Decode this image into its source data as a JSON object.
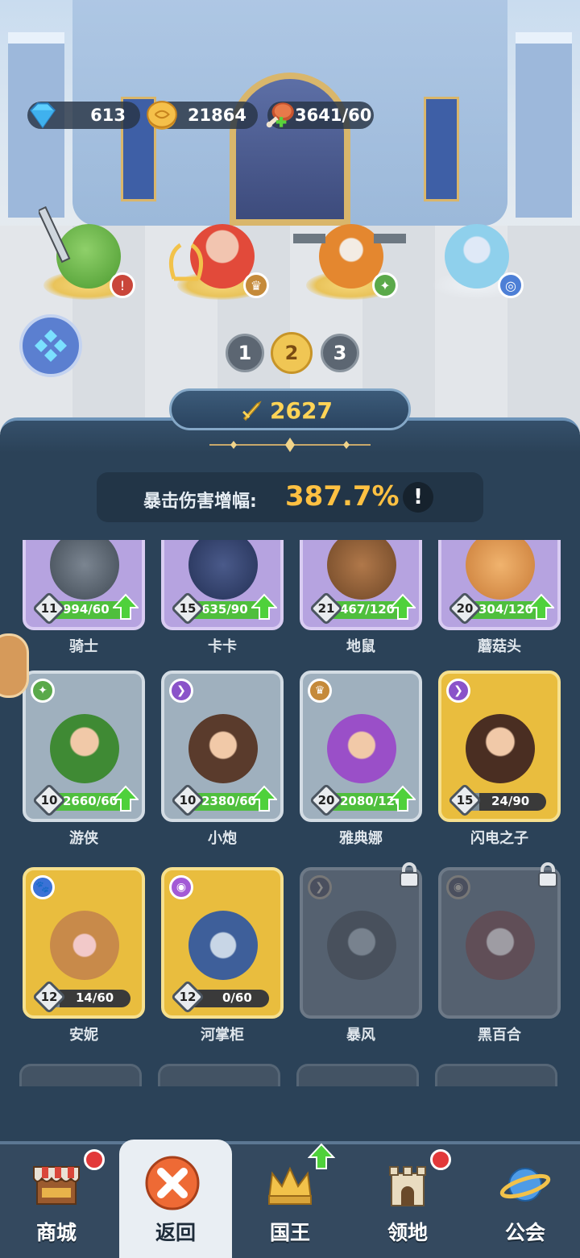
{
  "currencies": {
    "gems": "613",
    "gold": "21864",
    "stamina": "3641/60"
  },
  "team_tabs": [
    {
      "label": "1",
      "active": false
    },
    {
      "label": "2",
      "active": true
    },
    {
      "label": "3",
      "active": false
    }
  ],
  "power": "2627",
  "stat": {
    "label": "暴击伤害增幅:",
    "value": "387.7%",
    "info": "!"
  },
  "heroes_row1": [
    {
      "name": "骑士",
      "level": "11",
      "fragments": "994/60",
      "fill": 1.0,
      "rarity": "purple",
      "upgradable": true
    },
    {
      "name": "卡卡",
      "level": "15",
      "fragments": "635/90",
      "fill": 1.0,
      "rarity": "purple",
      "upgradable": true
    },
    {
      "name": "地鼠",
      "level": "21",
      "fragments": "467/120",
      "fill": 1.0,
      "rarity": "purple",
      "upgradable": true
    },
    {
      "name": "蘑菇头",
      "level": "20",
      "fragments": "304/120",
      "fill": 1.0,
      "rarity": "purple",
      "upgradable": true
    }
  ],
  "heroes_row2": [
    {
      "name": "游侠",
      "level": "10",
      "fragments": "2660/60",
      "fill": 1.0,
      "rarity": "grey",
      "upgradable": true
    },
    {
      "name": "小炮",
      "level": "10",
      "fragments": "2380/60",
      "fill": 1.0,
      "rarity": "grey",
      "upgradable": true
    },
    {
      "name": "雅典娜",
      "level": "20",
      "fragments": "2080/120",
      "fill": 1.0,
      "rarity": "grey",
      "upgradable": true
    },
    {
      "name": "闪电之子",
      "level": "15",
      "fragments": "24/90",
      "fill": 0.27,
      "rarity": "gold",
      "upgradable": false
    }
  ],
  "heroes_row3": [
    {
      "name": "安妮",
      "level": "12",
      "fragments": "14/60",
      "fill": 0.23,
      "rarity": "gold",
      "upgradable": false
    },
    {
      "name": "河掌柜",
      "level": "12",
      "fragments": "0/60",
      "fill": 0.0,
      "rarity": "gold",
      "upgradable": false
    },
    {
      "name": "暴风",
      "locked": true
    },
    {
      "name": "黑百合",
      "locked": true
    }
  ],
  "nav": {
    "shop": "商城",
    "back": "返回",
    "king": "国王",
    "territory": "领地",
    "guild": "公会"
  },
  "colors": {
    "accent_gold": "#ffc142",
    "panel": "#2b4258",
    "progress_green": "#4fbf3d",
    "alert_red": "#e2393a"
  }
}
